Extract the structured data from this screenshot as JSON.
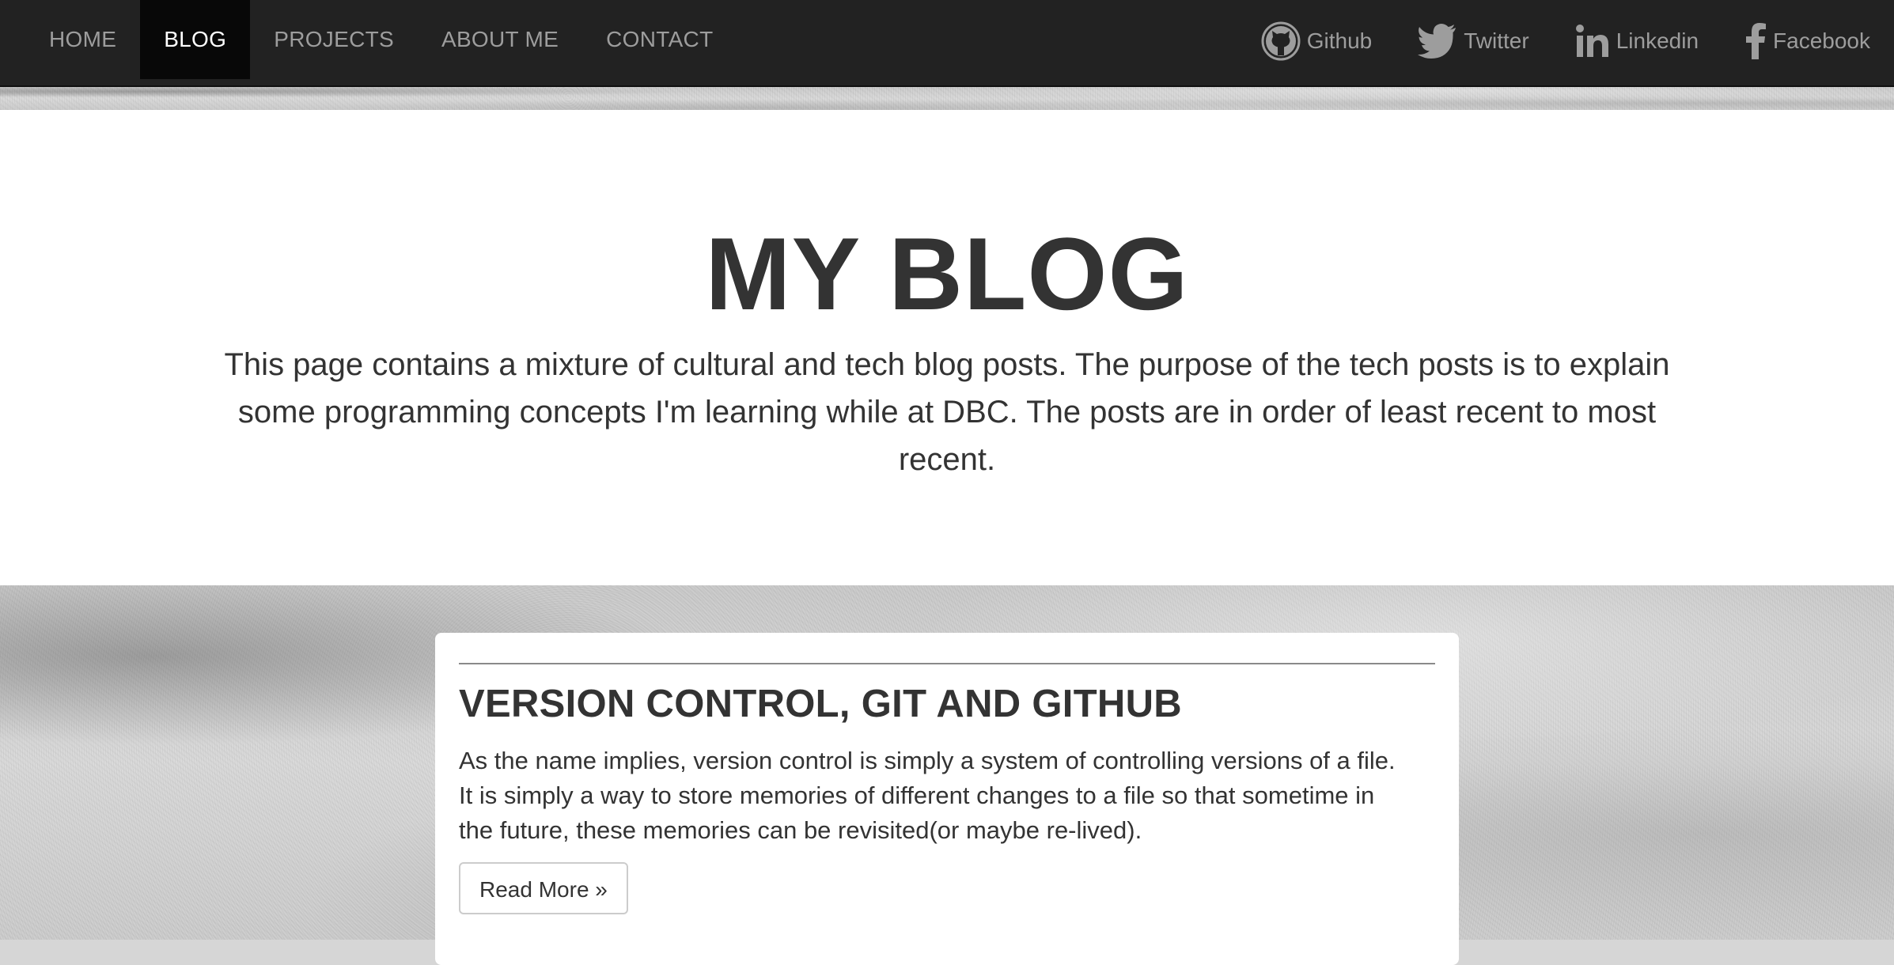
{
  "nav": {
    "items": [
      {
        "label": "HOME",
        "active": false
      },
      {
        "label": "BLOG",
        "active": true
      },
      {
        "label": "PROJECTS",
        "active": false
      },
      {
        "label": "ABOUT ME",
        "active": false
      },
      {
        "label": "CONTACT",
        "active": false
      }
    ],
    "social": [
      {
        "label": "Github",
        "icon": "github-icon"
      },
      {
        "label": "Twitter",
        "icon": "twitter-icon"
      },
      {
        "label": "Linkedin",
        "icon": "linkedin-icon"
      },
      {
        "label": "Facebook",
        "icon": "facebook-icon"
      }
    ]
  },
  "hero": {
    "title": "MY BLOG",
    "description": "This page contains a mixture of cultural and tech blog posts. The purpose of the tech posts is to explain some programming concepts I'm learning while at DBC. The posts are in order of least recent to most recent."
  },
  "posts": [
    {
      "title": "VERSION CONTROL, GIT AND GITHUB",
      "excerpt": "As the name implies, version control is simply a system of controlling versions of a file. It is simply a way to store memories of different changes to a file so that sometime in the future, these memories can be revisited(or maybe re-lived).",
      "read_more": "Read More »"
    }
  ],
  "colors": {
    "navbar_bg": "#222222",
    "nav_active_bg": "#080808",
    "nav_text": "#9d9d9d",
    "nav_active_text": "#ffffff",
    "text": "#333333"
  }
}
